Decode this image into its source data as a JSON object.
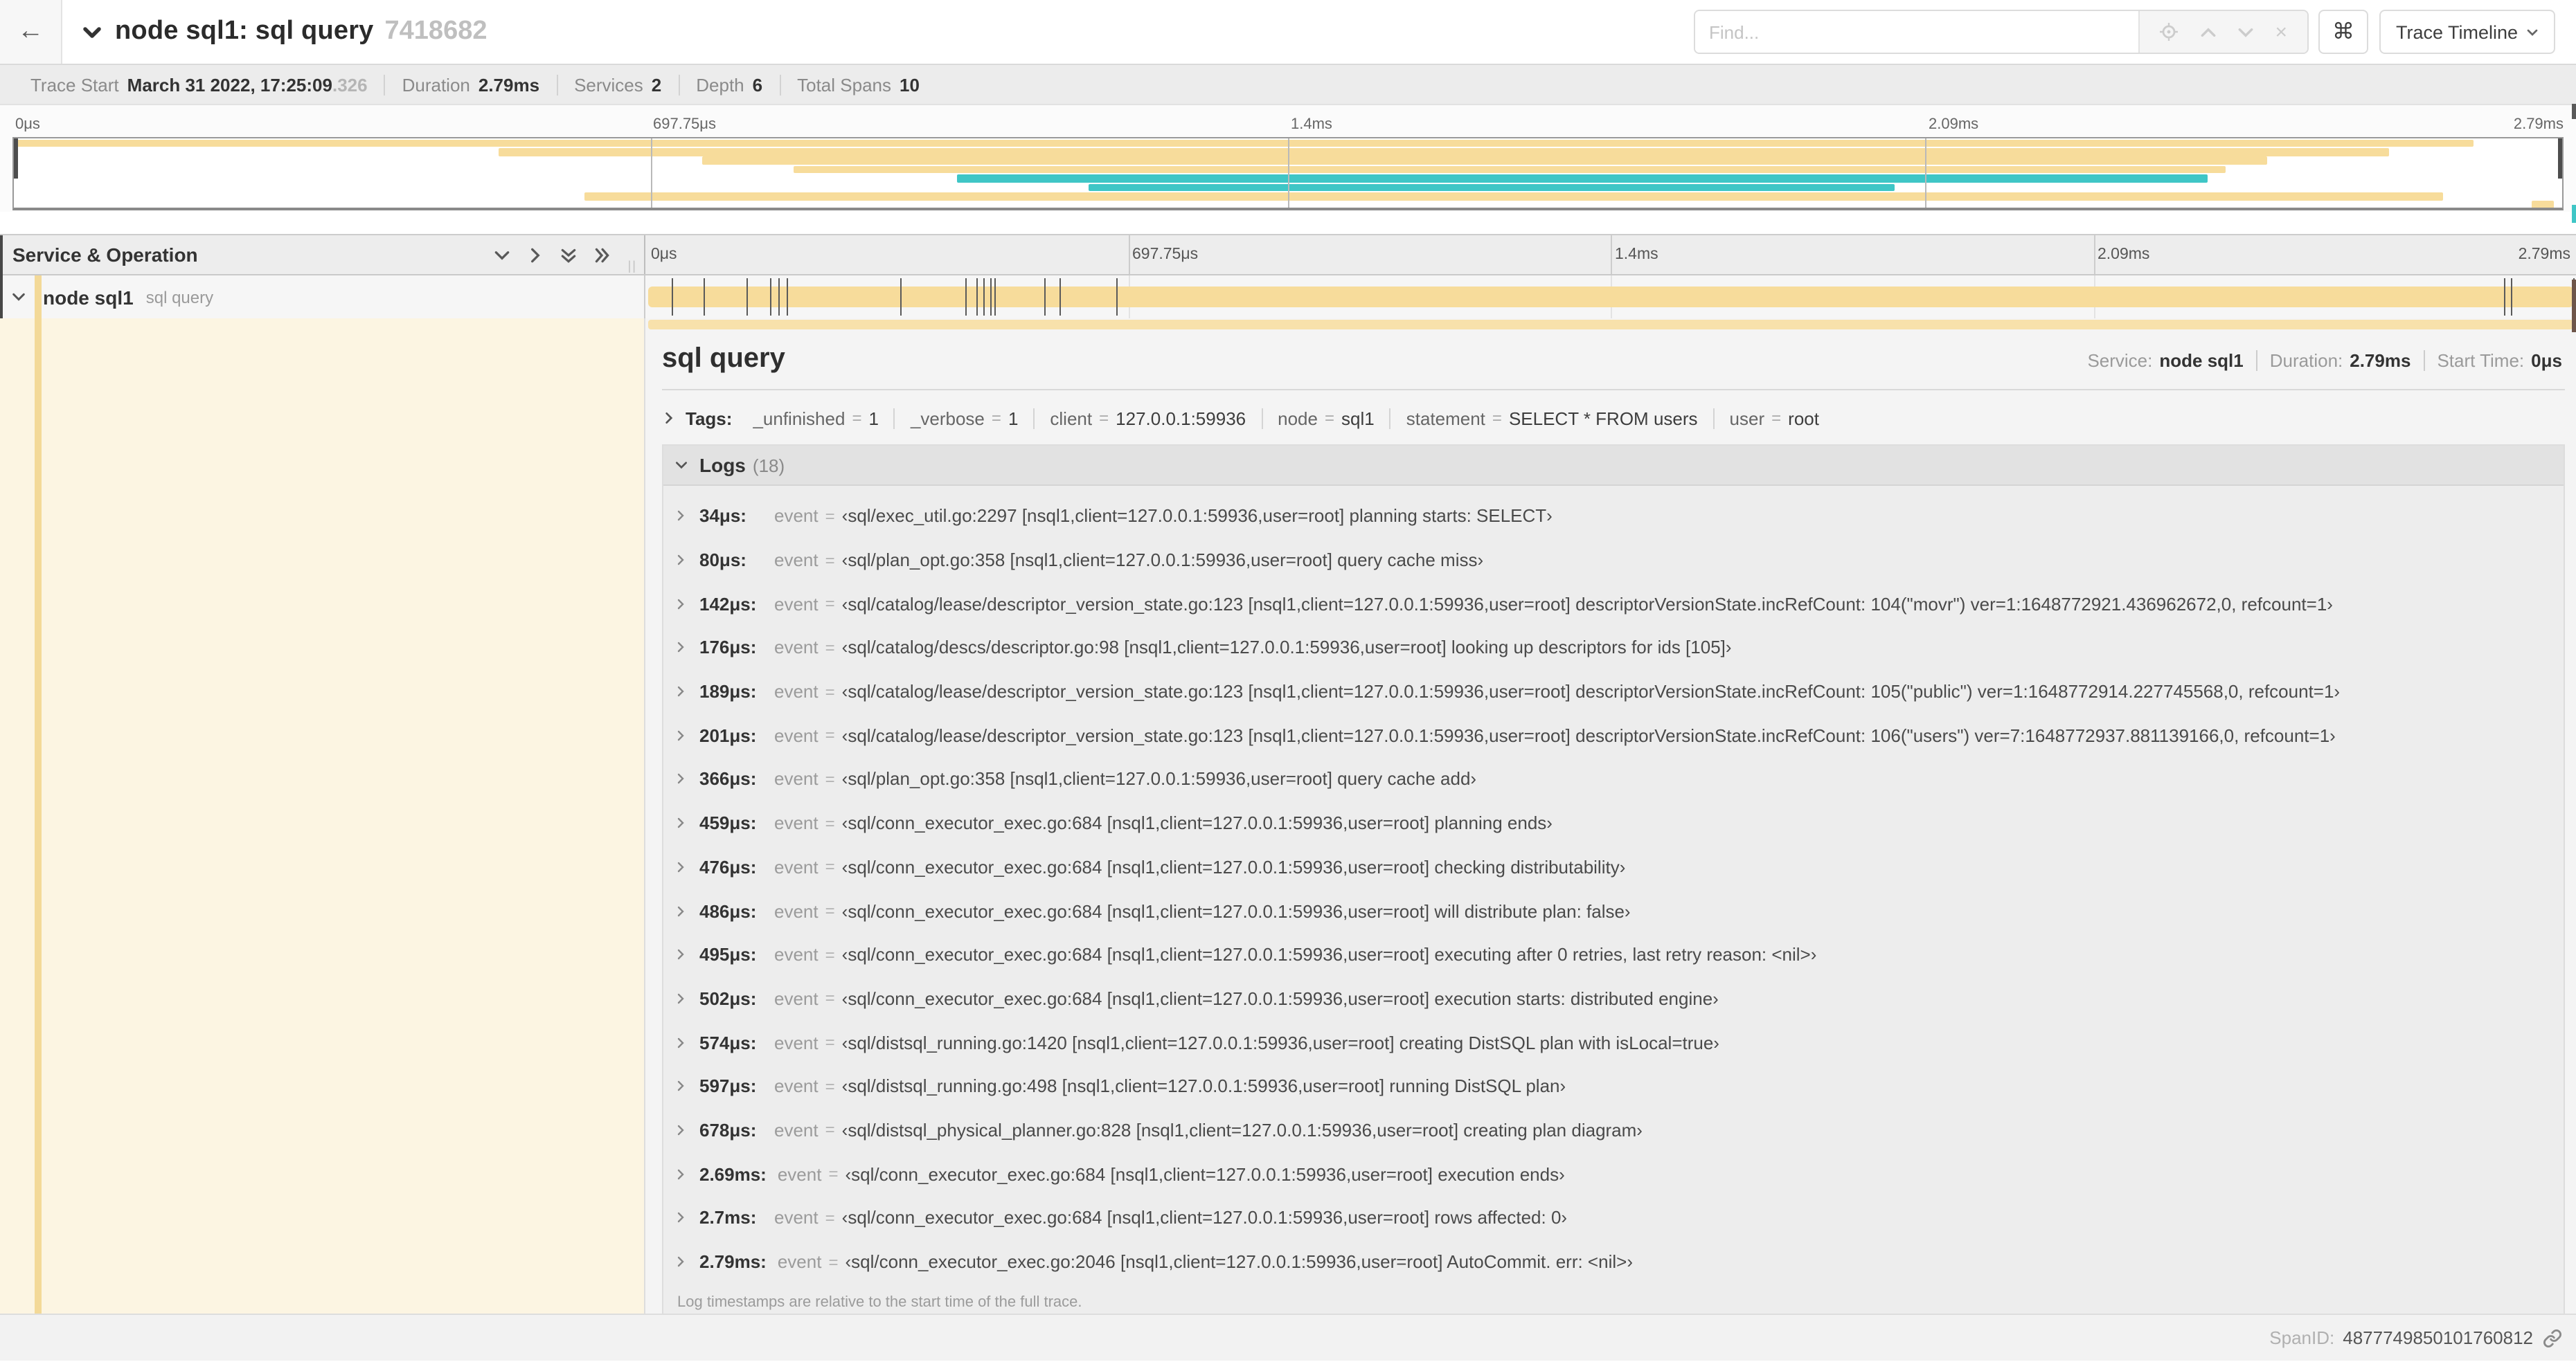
{
  "ui": {
    "eq": "=",
    "back_icon": "←",
    "cmd_icon": "⌘",
    "close_icon": "×",
    "grip": "||"
  },
  "header": {
    "title": "node sql1: sql query",
    "trace_id": "7418682",
    "find_placeholder": "Find...",
    "view_selector": "Trace Timeline"
  },
  "summary": {
    "items": [
      {
        "label": "Trace Start",
        "value": "March 31 2022, 17:25:09",
        "suffix": ".326"
      },
      {
        "label": "Duration",
        "value": "2.79ms",
        "suffix": ""
      },
      {
        "label": "Services",
        "value": "2",
        "suffix": ""
      },
      {
        "label": "Depth",
        "value": "6",
        "suffix": ""
      },
      {
        "label": "Total Spans",
        "value": "10",
        "suffix": ""
      }
    ]
  },
  "timeline": {
    "duration_us": 2790,
    "ticks": [
      {
        "label": "0μs"
      },
      {
        "label": "697.75μs"
      },
      {
        "label": "1.4ms"
      },
      {
        "label": "2.09ms"
      },
      {
        "label": "2.79ms"
      }
    ],
    "grid_fractions": [
      0.25,
      0.5,
      0.75
    ]
  },
  "minimap": {
    "spans": [
      {
        "color": "tan",
        "start": 0.0,
        "end": 0.965
      },
      {
        "color": "tan",
        "start": 0.19,
        "end": 0.932
      },
      {
        "color": "tan",
        "start": 0.27,
        "end": 0.884
      },
      {
        "color": "tan",
        "start": 0.306,
        "end": 0.868
      },
      {
        "color": "teal",
        "start": 0.37,
        "end": 0.861
      },
      {
        "color": "teal",
        "start": 0.422,
        "end": 0.738
      },
      {
        "color": "tan",
        "start": 0.224,
        "end": 0.953
      },
      {
        "color": "tan",
        "start": 0.988,
        "end": 0.997
      }
    ]
  },
  "colors": {
    "tan": "#f7dc9b",
    "tan_light": "#f8e1ab",
    "teal": "#3fc6c6",
    "stripe": "#f3d998",
    "cream": "#fcf5e2"
  },
  "left_panel": {
    "header": "Service & Operation"
  },
  "span_row": {
    "service": "node sql1",
    "operation": "sql query",
    "log_marks_us": [
      34,
      80,
      142,
      176,
      189,
      201,
      366,
      459,
      476,
      486,
      495,
      502,
      574,
      597,
      678,
      2690,
      2700,
      2790
    ]
  },
  "detail": {
    "title": "sql query",
    "meta": [
      {
        "label": "Service:",
        "value": "node sql1"
      },
      {
        "label": "Duration:",
        "value": "2.79ms"
      },
      {
        "label": "Start Time:",
        "value": "0μs"
      }
    ],
    "tags": {
      "label": "Tags:",
      "items": [
        {
          "key": "_unfinished",
          "value": "1"
        },
        {
          "key": "_verbose",
          "value": "1"
        },
        {
          "key": "client",
          "value": "127.0.0.1:59936"
        },
        {
          "key": "node",
          "value": "sql1"
        },
        {
          "key": "statement",
          "value": "SELECT * FROM users"
        },
        {
          "key": "user",
          "value": "root"
        }
      ]
    },
    "logs": {
      "label": "Logs",
      "count": "(18)",
      "field": "event",
      "entries": [
        {
          "time": "34μs:",
          "value": "‹sql/exec_util.go:2297 [nsql1,client=127.0.0.1:59936,user=root] planning starts: SELECT›"
        },
        {
          "time": "80μs:",
          "value": "‹sql/plan_opt.go:358 [nsql1,client=127.0.0.1:59936,user=root] query cache miss›"
        },
        {
          "time": "142μs:",
          "value": "‹sql/catalog/lease/descriptor_version_state.go:123 [nsql1,client=127.0.0.1:59936,user=root] descriptorVersionState.incRefCount: 104(\"movr\") ver=1:1648772921.436962672,0, refcount=1›"
        },
        {
          "time": "176μs:",
          "value": "‹sql/catalog/descs/descriptor.go:98 [nsql1,client=127.0.0.1:59936,user=root] looking up descriptors for ids [105]›"
        },
        {
          "time": "189μs:",
          "value": "‹sql/catalog/lease/descriptor_version_state.go:123 [nsql1,client=127.0.0.1:59936,user=root] descriptorVersionState.incRefCount: 105(\"public\") ver=1:1648772914.227745568,0, refcount=1›"
        },
        {
          "time": "201μs:",
          "value": "‹sql/catalog/lease/descriptor_version_state.go:123 [nsql1,client=127.0.0.1:59936,user=root] descriptorVersionState.incRefCount: 106(\"users\") ver=7:1648772937.881139166,0, refcount=1›"
        },
        {
          "time": "366μs:",
          "value": "‹sql/plan_opt.go:358 [nsql1,client=127.0.0.1:59936,user=root] query cache add›"
        },
        {
          "time": "459μs:",
          "value": "‹sql/conn_executor_exec.go:684 [nsql1,client=127.0.0.1:59936,user=root] planning ends›"
        },
        {
          "time": "476μs:",
          "value": "‹sql/conn_executor_exec.go:684 [nsql1,client=127.0.0.1:59936,user=root] checking distributability›"
        },
        {
          "time": "486μs:",
          "value": "‹sql/conn_executor_exec.go:684 [nsql1,client=127.0.0.1:59936,user=root] will distribute plan: false›"
        },
        {
          "time": "495μs:",
          "value": "‹sql/conn_executor_exec.go:684 [nsql1,client=127.0.0.1:59936,user=root] executing after 0 retries, last retry reason: <nil>›"
        },
        {
          "time": "502μs:",
          "value": "‹sql/conn_executor_exec.go:684 [nsql1,client=127.0.0.1:59936,user=root] execution starts: distributed engine›"
        },
        {
          "time": "574μs:",
          "value": "‹sql/distsql_running.go:1420 [nsql1,client=127.0.0.1:59936,user=root] creating DistSQL plan with isLocal=true›"
        },
        {
          "time": "597μs:",
          "value": "‹sql/distsql_running.go:498 [nsql1,client=127.0.0.1:59936,user=root] running DistSQL plan›"
        },
        {
          "time": "678μs:",
          "value": "‹sql/distsql_physical_planner.go:828 [nsql1,client=127.0.0.1:59936,user=root] creating plan diagram›"
        },
        {
          "time": "2.69ms:",
          "value": "‹sql/conn_executor_exec.go:684 [nsql1,client=127.0.0.1:59936,user=root] execution ends›"
        },
        {
          "time": "2.7ms:",
          "value": "‹sql/conn_executor_exec.go:684 [nsql1,client=127.0.0.1:59936,user=root] rows affected: 0›"
        },
        {
          "time": "2.79ms:",
          "value": "‹sql/conn_executor_exec.go:2046 [nsql1,client=127.0.0.1:59936,user=root] AutoCommit. err: <nil>›"
        }
      ],
      "footnote": "Log timestamps are relative to the start time of the full trace."
    },
    "span_id_label": "SpanID:",
    "span_id": "4877749850101760812"
  }
}
